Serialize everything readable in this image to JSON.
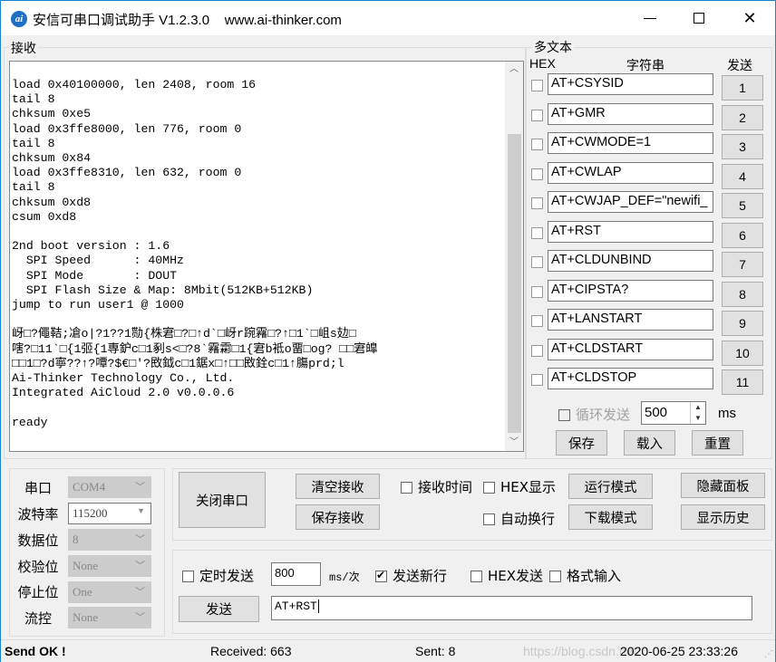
{
  "titlebar": {
    "icon_label": "ai",
    "title": "安信可串口调试助手 V1.2.3.0    www.ai-thinker.com",
    "minimize": "minimize",
    "maximize": "maximize",
    "close": "✕"
  },
  "receive": {
    "group_label": "接收",
    "text": "load 0x40100000, len 2408, room 16\ntail 8\nchksum 0xe5\nload 0x3ffe8000, len 776, room 0\ntail 8\nchksum 0x84\nload 0x3ffe8310, len 632, room 0\ntail 8\nchksum 0xd8\ncsum 0xd8\n\n2nd boot version : 1.6\n  SPI Speed      : 40MHz\n  SPI Mode       : DOUT\n  SPI Flash Size & Map: 8Mbit(512KB+512KB)\njump to run user1 @ 1000\n\n岈□?僶鞊;凔o|?1??1勚{株宭□?□↑d`□岈r踠霿□?↑□1`□岨s攰□\n嗐?□11`□{1弬{1専鈩c□1剢s<□?8`霿霦□1{宭b袛o畱□og? □□宭皥\n□□1□?d寧??↑?嘾?$€□'?敃鉞c□1鋸x□↑□□敃銓c□1↑膓prd;l\nAi-Thinker Technology Co., Ltd.\nIntegrated AiCloud 2.0 v0.0.0.6\n\nready"
  },
  "multitext": {
    "group_label": "多文本",
    "hex_header": "HEX",
    "string_header": "字符串",
    "send_header": "发送",
    "rows": [
      {
        "hex": false,
        "value": "AT+CSYSID",
        "button": "1"
      },
      {
        "hex": false,
        "value": "AT+GMR",
        "button": "2"
      },
      {
        "hex": false,
        "value": "AT+CWMODE=1",
        "button": "3"
      },
      {
        "hex": false,
        "value": "AT+CWLAP",
        "button": "4"
      },
      {
        "hex": false,
        "value": "AT+CWJAP_DEF=\"newifi_",
        "button": "5"
      },
      {
        "hex": false,
        "value": "AT+RST",
        "button": "6"
      },
      {
        "hex": false,
        "value": "AT+CLDUNBIND",
        "button": "7"
      },
      {
        "hex": false,
        "value": "AT+CIPSTA?",
        "button": "8"
      },
      {
        "hex": false,
        "value": "AT+LANSTART",
        "button": "9"
      },
      {
        "hex": false,
        "value": "AT+CLDSTART",
        "button": "10"
      },
      {
        "hex": false,
        "value": "AT+CLDSTOP",
        "button": "11"
      }
    ],
    "loop_send_label": "循环发送",
    "loop_interval": "500",
    "loop_unit": "ms",
    "save_label": "保存",
    "load_label": "载入",
    "reset_label": "重置"
  },
  "serial": {
    "port_label": "串口",
    "port_value": "COM4",
    "baud_label": "波特率",
    "baud_value": "115200",
    "databits_label": "数据位",
    "databits_value": "8",
    "parity_label": "校验位",
    "parity_value": "None",
    "stopbits_label": "停止位",
    "stopbits_value": "One",
    "flow_label": "流控",
    "flow_value": "None"
  },
  "controls": {
    "close_port": "关闭串口",
    "clear_recv": "清空接收",
    "save_recv": "保存接收",
    "recv_time": "接收时间",
    "hex_display": "HEX显示",
    "auto_newline": "自动换行",
    "run_mode": "运行模式",
    "download_mode": "下载模式",
    "hide_panel": "隐藏面板",
    "show_history": "显示历史"
  },
  "send": {
    "timed_send": "定时发送",
    "interval": "800",
    "interval_unit": "ms/次",
    "send_newline": "发送新行",
    "send_newline_checked": true,
    "hex_send": "HEX发送",
    "format_input": "格式输入",
    "send_button": "发送",
    "input_value": "AT+RST"
  },
  "status": {
    "message": "Send OK !",
    "received": "Received: 663",
    "sent": "Sent: 8",
    "watermark": "https://blog.csdn.net/",
    "datetime": "2020-06-25 23:33:26"
  }
}
